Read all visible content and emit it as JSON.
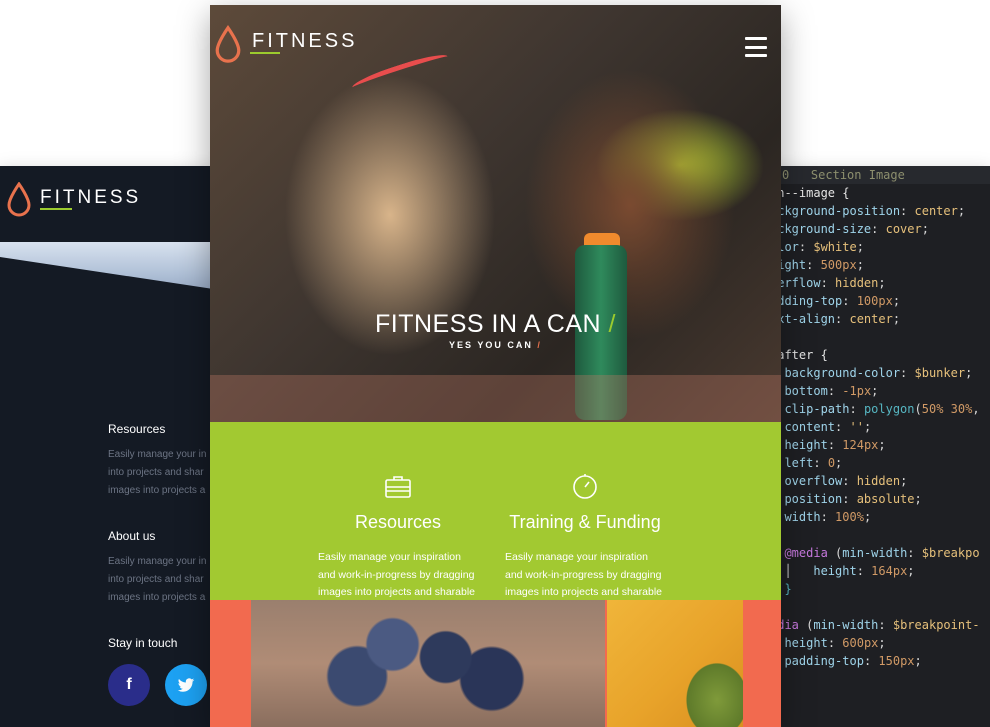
{
  "brand": {
    "name": "FITNESS",
    "accent": "#9ccb2e",
    "drop_color": "#e8724d"
  },
  "left_panel": {
    "sections": [
      {
        "title": "Resources",
        "lines": [
          "Easily manage your in",
          "into projects and shar",
          "images into projects a"
        ]
      },
      {
        "title": "About us",
        "lines": [
          "Easily manage your in",
          "into projects and shar",
          "images into projects a"
        ]
      },
      {
        "title": "Stay in touch",
        "lines": []
      }
    ],
    "social": [
      {
        "name": "facebook",
        "glyph": "f",
        "color": "#2a2d8a"
      },
      {
        "name": "twitter",
        "glyph": "t",
        "color": "#1da1f2"
      }
    ]
  },
  "hero": {
    "title": "FITNESS IN A CAN",
    "title_slash": "/",
    "subtitle": "YES YOU CAN",
    "subtitle_slash": "/"
  },
  "features": [
    {
      "icon": "briefcase-icon",
      "title": "Resources",
      "lines": [
        "Easily manage your inspiration",
        "and work-in-progress by dragging",
        "images into projects and sharable"
      ]
    },
    {
      "icon": "stopwatch-icon",
      "title": "Training & Funding",
      "lines": [
        "Easily manage your inspiration",
        "and work-in-progress by dragging",
        "images into projects and sharable"
      ]
    }
  ],
  "code_editor": {
    "header_num": "0",
    "header_text": "Section Image",
    "colors": {
      "background": "#1e1f23",
      "property": "#9fd4ea",
      "value": "#e6c07b",
      "number": "#d19a66"
    }
  }
}
